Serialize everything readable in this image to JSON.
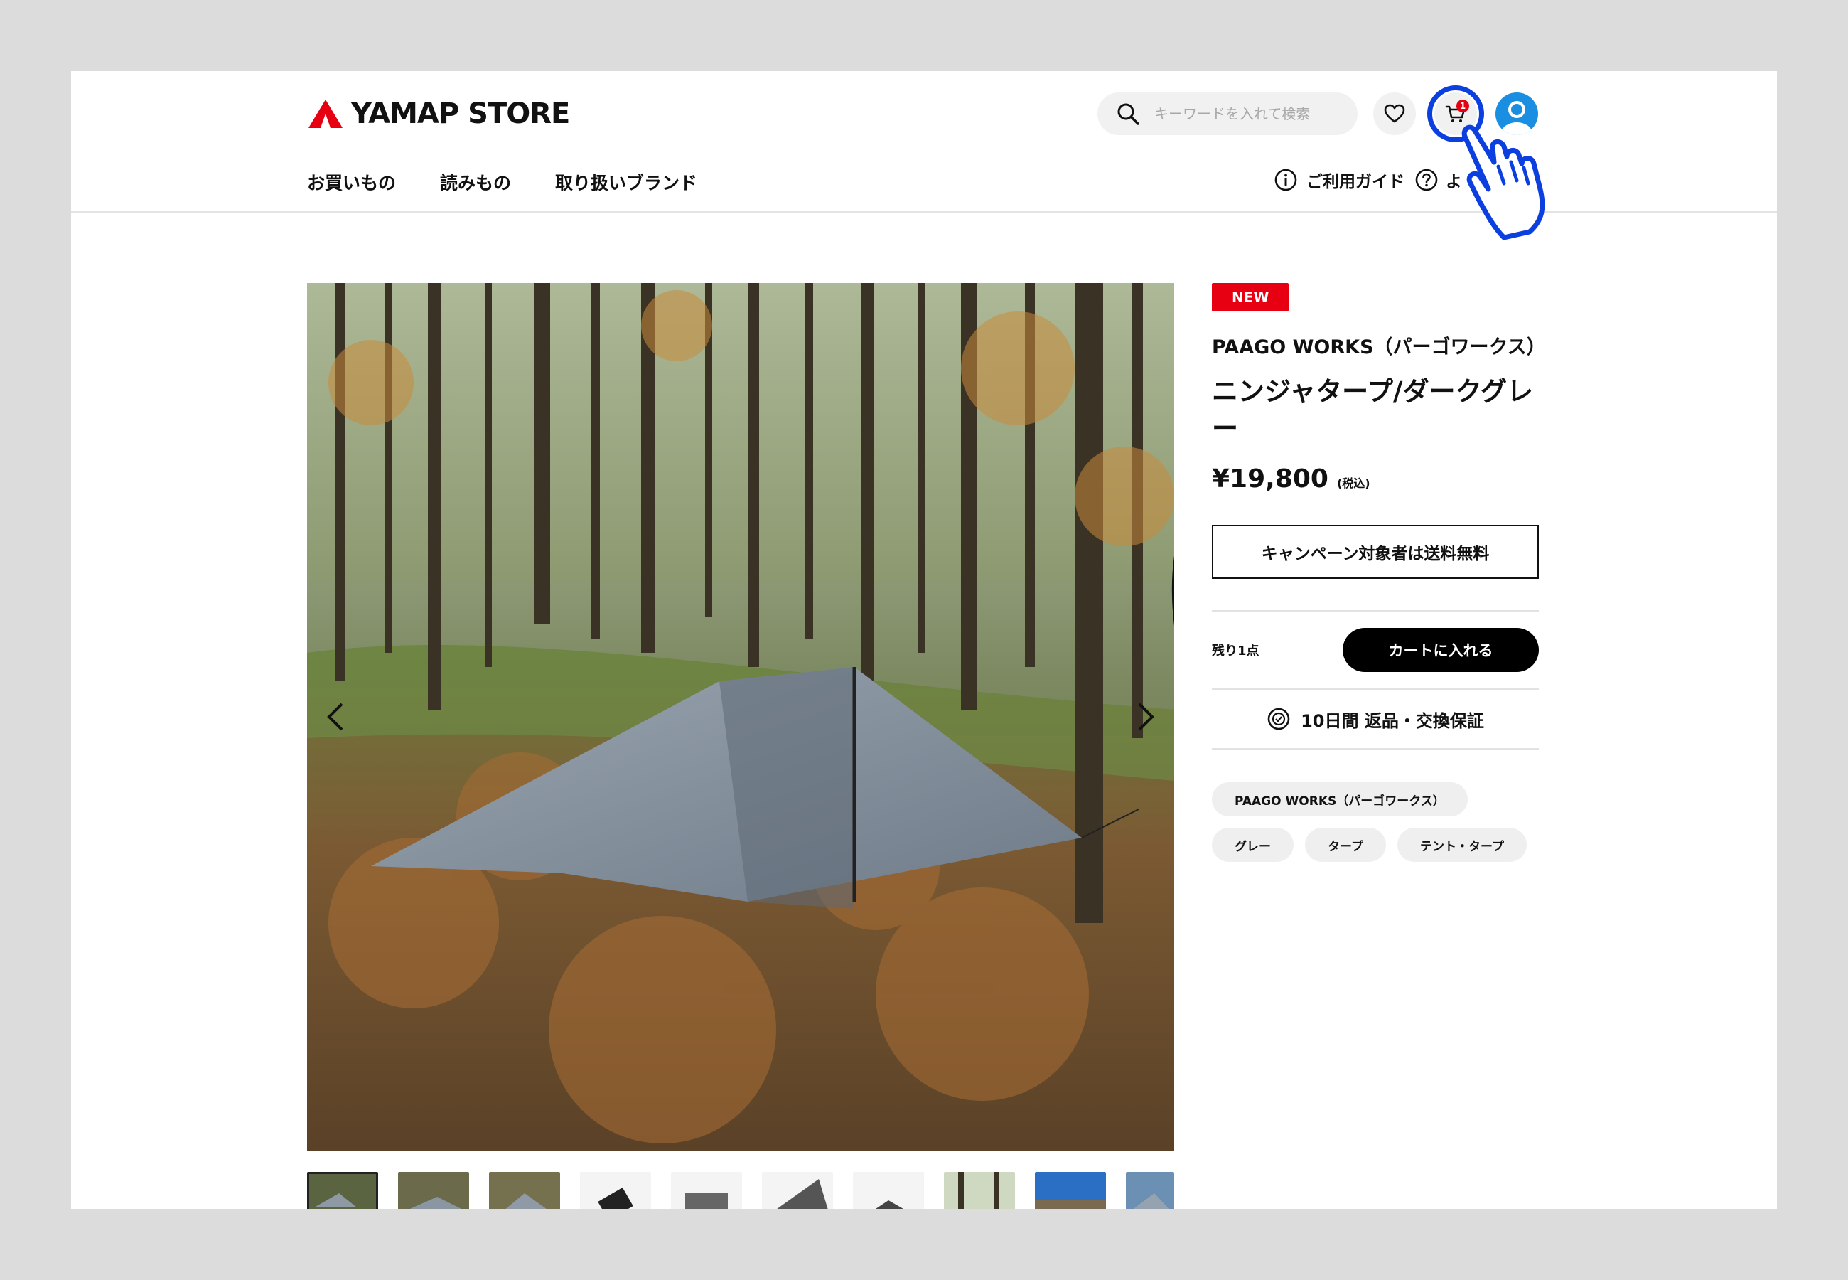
{
  "header": {
    "logo_text": "YAMAP STORE",
    "search_placeholder": "キーワードを入れて検索",
    "cart_count": "1",
    "nav": [
      "お買いもの",
      "読みもの",
      "取り扱いブランド"
    ],
    "guide_label": "ご利用ガイド",
    "help_label": "よ"
  },
  "product": {
    "badge": "NEW",
    "brand": "PAAGO WORKS（パーゴワークス）",
    "title": "ニンジャタープ/ダークグレー",
    "price": "¥19,800",
    "tax_note": "(税込)",
    "shipping_note": "キャンペーン対象者は送料無料",
    "stock": "残り1点",
    "add_to_cart": "カートに入れる",
    "guarantee": "10日間 返品・交換保証",
    "tags": [
      "PAAGO WORKS（パーゴワークス）",
      "グレー",
      "タープ",
      "テント・タープ"
    ]
  },
  "colors": {
    "accent_red": "#e60012",
    "pointer_blue": "#0c3fe0",
    "avatar_blue": "#1a8ee0"
  },
  "icons": [
    "search-icon",
    "heart-icon",
    "cart-icon",
    "avatar-icon",
    "info-icon",
    "question-icon",
    "chevron-left-icon",
    "chevron-right-icon",
    "guarantee-icon",
    "pointer-hand-icon"
  ]
}
